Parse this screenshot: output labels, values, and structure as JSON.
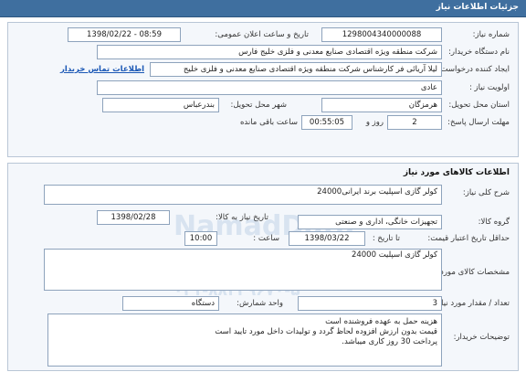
{
  "page": {
    "title": "جزئیات اطلاعات نیاز"
  },
  "header": {
    "need_number_label": "شماره نیاز:",
    "need_number": "1298004340000088",
    "announce_label": "تاریخ و ساعت اعلان عمومی:",
    "announce_value": "1398/02/22 - 08:59",
    "buyer_org_label": "نام دستگاه خریدار:",
    "buyer_org": "شرکت منطقه ویژه اقتصادی صنایع معدنی و فلزی خلیج فارس",
    "creator_label": "ایجاد کننده درخواست:",
    "creator": "لیلا آریائی فر کارشناس شرکت منطقه ویژه اقتصادی صنایع معدنی و فلزی خلیج",
    "contact_link": "اطلاعات تماس خریدار",
    "priority_label": "اولویت نیاز :",
    "priority": "عادی",
    "province_label": "استان محل تحویل:",
    "province": "هرمزگان",
    "city_label": "شهر محل تحویل:",
    "city": "بندرعباس",
    "deadline_label": "مهلت ارسال پاسخ:",
    "deadline_days": "2",
    "days_word": "روز و",
    "deadline_time": "00:55:05",
    "remaining_word": "ساعت باقی مانده"
  },
  "goods": {
    "section_title": "اطلاعات کالاهای مورد نیاز",
    "general_desc_label": "شرح کلی نیاز:",
    "general_desc": "کولر گازی اسپلیت  برند ایرانی24000",
    "need_date_label": "تاریخ نیاز به کالا:",
    "need_date": "1398/02/28",
    "group_label": "گروه کالا:",
    "group": "تجهیزات خانگی، اداری و صنعتی",
    "min_validity_label": "حداقل تاریخ اعتبار قیمت:",
    "until_date_label": "تا تاریخ :",
    "until_date": "1398/03/22",
    "time_label": "ساعت :",
    "time": "10:00",
    "item_spec_label": "مشخصات کالای مورد نیاز:",
    "item_spec": "کولر گازی اسپلیت 24000",
    "qty_label": "تعداد / مقدار مورد نیاز:",
    "qty": "3",
    "unit_label": "واحد شمارش:",
    "unit": "دستگاه",
    "buyer_notes_label": "توضیحات خریدار:",
    "buyer_notes_1": "هزینه حمل به عهده فروشنده است",
    "buyer_notes_2": "قیمت بدون ارزش افزوده لحاظ گردد و تولیدات داخل مورد تایید است",
    "buyer_notes_3": "پرداخت 30 روز کاری میباشد."
  },
  "watermark": {
    "line1": "پایگاه اطلاع رسانی مناقصه و مزایده",
    "line2": "۰۲۱-۸۸۳۴۹۶۷۰-۵",
    "brand": "NamadData"
  },
  "colors": {
    "titlebar": "#3f6f9f",
    "panel_bg": "#f4f7fb",
    "link": "#1a57b5"
  }
}
